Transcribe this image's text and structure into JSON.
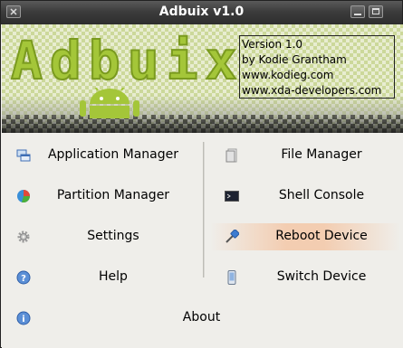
{
  "window": {
    "title": "Adbuix v1.0"
  },
  "banner": {
    "logo_text": "Adbuix",
    "version_lines": [
      "Version 1.0",
      "by Kodie Grantham",
      "www.kodieg.com",
      "www.xda-developers.com"
    ]
  },
  "menu": {
    "left": [
      {
        "label": "Application Manager",
        "icon": "windows-icon"
      },
      {
        "label": "Partition Manager",
        "icon": "pie-chart-icon"
      },
      {
        "label": "Settings",
        "icon": "gear-icon"
      },
      {
        "label": "Help",
        "icon": "help-icon"
      }
    ],
    "right": [
      {
        "label": "File Manager",
        "icon": "file-icon"
      },
      {
        "label": "Shell Console",
        "icon": "terminal-icon"
      },
      {
        "label": "Reboot Device",
        "icon": "usb-icon",
        "highlighted": true
      },
      {
        "label": "Switch Device",
        "icon": "phone-icon"
      }
    ],
    "about": {
      "label": "About",
      "icon": "info-icon"
    }
  },
  "colors": {
    "android_green": "#a4c639",
    "highlight": "#f3cdb1"
  }
}
